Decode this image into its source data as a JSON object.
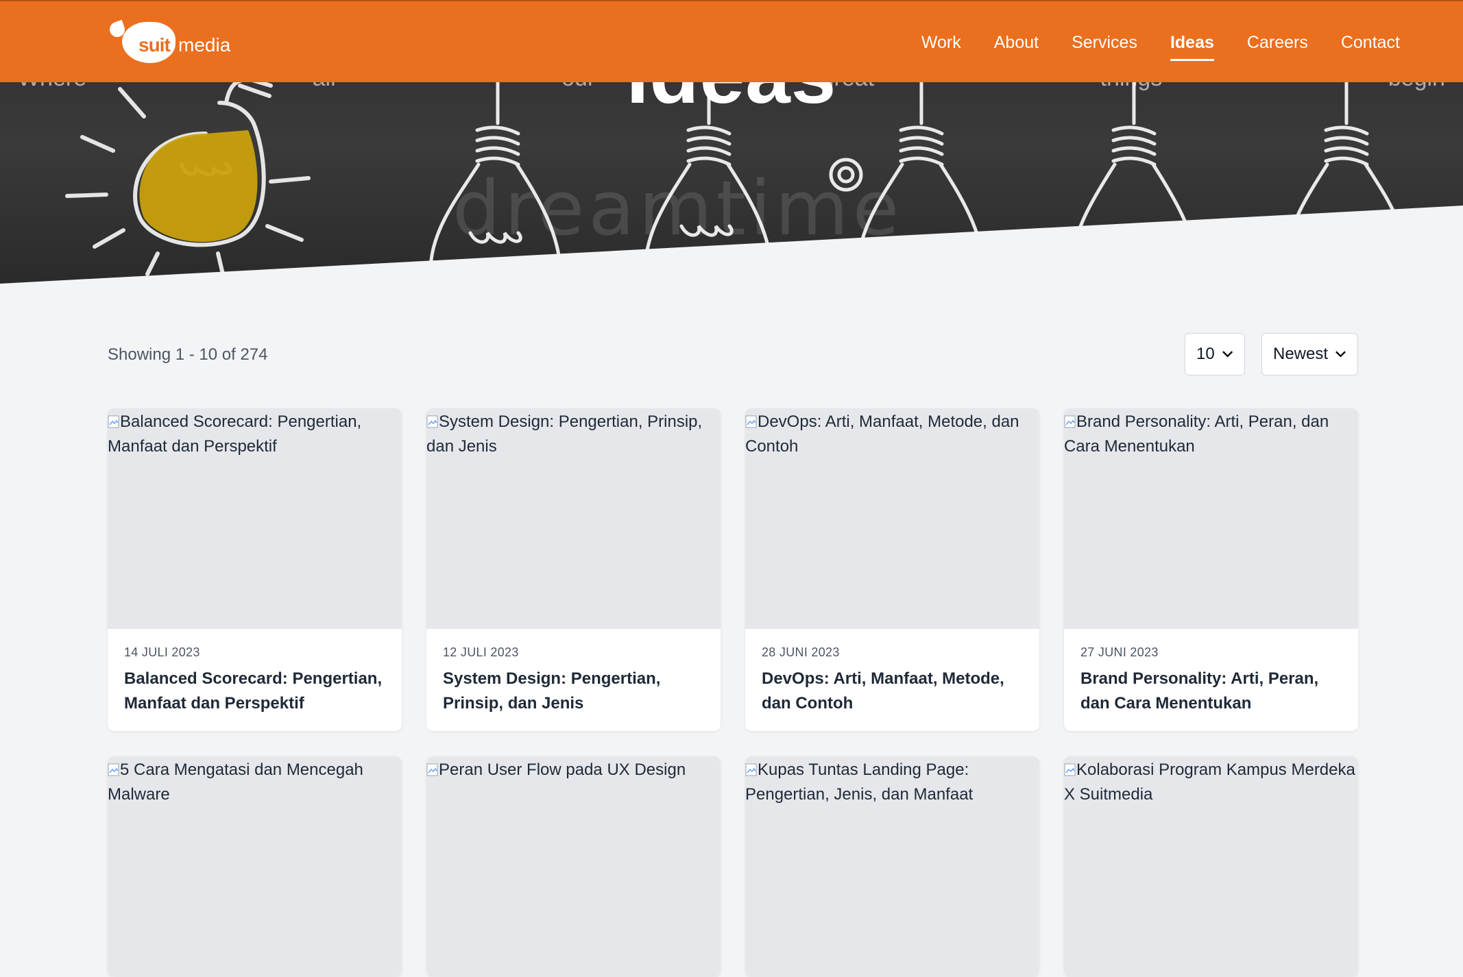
{
  "brand": {
    "logo_suit": "suit",
    "logo_media": "media",
    "accent": "#ea6f1e"
  },
  "nav": {
    "items": [
      {
        "label": "Work"
      },
      {
        "label": "About"
      },
      {
        "label": "Services"
      },
      {
        "label": "Ideas",
        "active": true
      },
      {
        "label": "Careers"
      },
      {
        "label": "Contact"
      }
    ]
  },
  "hero": {
    "title": "Ideas",
    "subtitle": "Where all our great things begin",
    "watermark": "dreamtime"
  },
  "listing": {
    "showing": "Showing 1 - 10 of 274",
    "per_page": "10",
    "sort": "Newest"
  },
  "posts": [
    {
      "date": "14 JULI 2023",
      "title": "Balanced Scorecard: Pengertian, Manfaat dan Perspektif",
      "img_alt": "Balanced Scorecard: Pengertian, Manfaat dan Perspektif"
    },
    {
      "date": "12 JULI 2023",
      "title": "System Design: Pengertian, Prinsip, dan Jenis",
      "img_alt": "System Design: Pengertian, Prinsip, dan Jenis"
    },
    {
      "date": "28 JUNI 2023",
      "title": "DevOps: Arti, Manfaat, Metode, dan Contoh",
      "img_alt": "DevOps: Arti, Manfaat, Metode, dan Contoh"
    },
    {
      "date": "27 JUNI 2023",
      "title": "Brand Personality: Arti, Peran, dan Cara Menentukan",
      "img_alt": "Brand Personality: Arti, Peran, dan Cara Menentukan"
    },
    {
      "img_alt": "5 Cara Mengatasi dan Mencegah Malware"
    },
    {
      "img_alt": "Peran User Flow pada UX Design"
    },
    {
      "img_alt": "Kupas Tuntas Landing Page: Pengertian, Jenis, dan Manfaat"
    },
    {
      "img_alt": "Kolaborasi Program Kampus Merdeka X Suitmedia"
    }
  ]
}
